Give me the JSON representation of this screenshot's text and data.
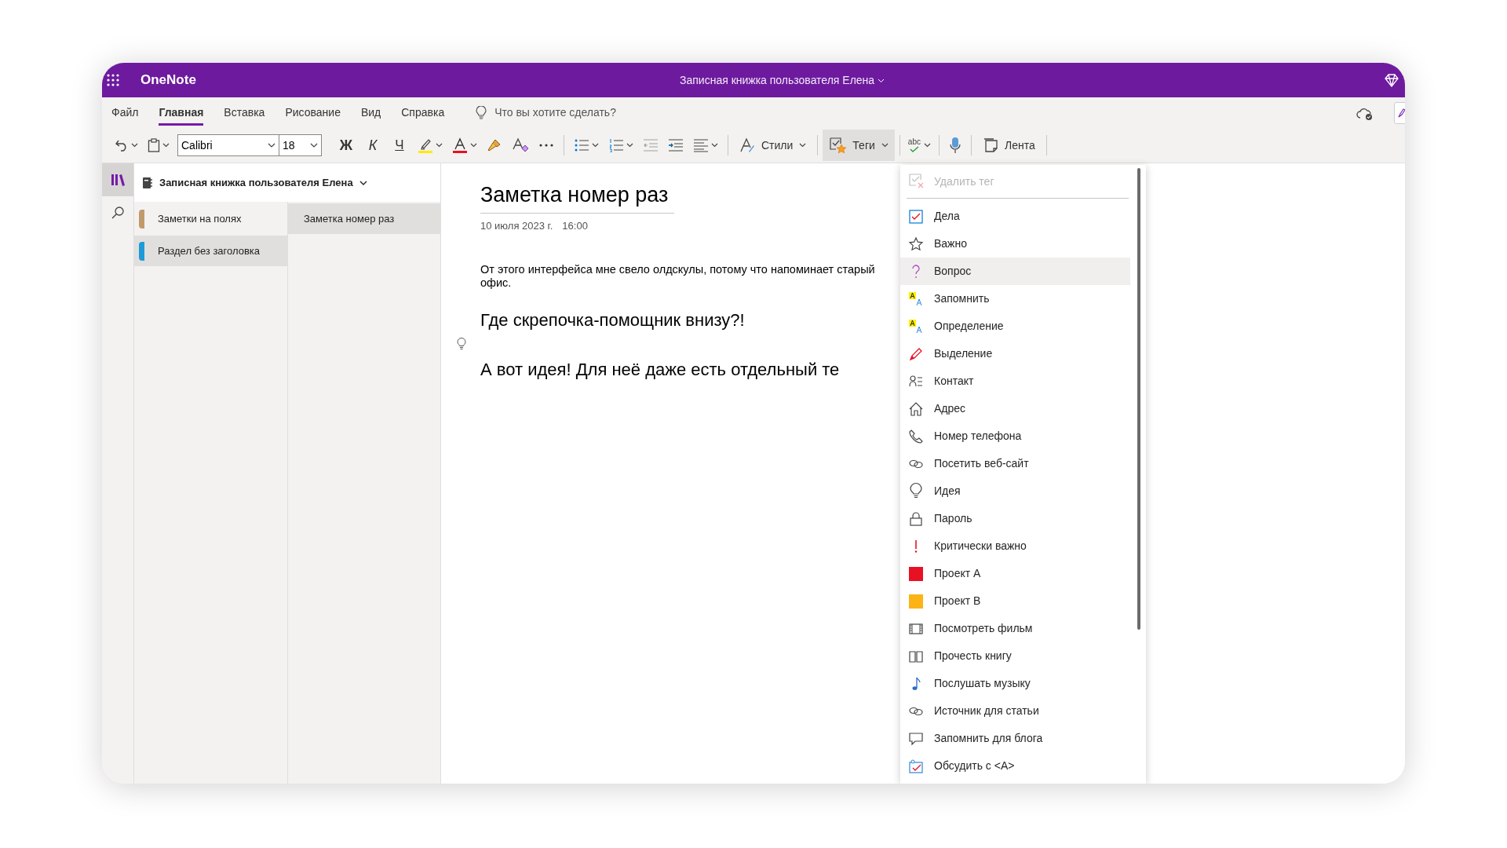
{
  "app": {
    "name": "OneNote",
    "title": "Записная книжка пользователя Елена"
  },
  "ribbon_tabs": [
    {
      "label": "Файл",
      "selected": false
    },
    {
      "label": "Главная",
      "selected": true
    },
    {
      "label": "Вставка",
      "selected": false
    },
    {
      "label": "Рисование",
      "selected": false
    },
    {
      "label": "Вид",
      "selected": false
    },
    {
      "label": "Справка",
      "selected": false
    }
  ],
  "tell_me": {
    "placeholder": "Что вы хотите сделать?"
  },
  "toolbar": {
    "font": "Calibri",
    "size": "18",
    "bold": "Ж",
    "italic": "К",
    "underline": "Ч",
    "spelling": "abc",
    "buttons": [
      {
        "kind": "styles",
        "label": "Стили",
        "selected": false
      },
      {
        "kind": "tags",
        "label": "Теги",
        "selected": true
      },
      {
        "kind": "feed",
        "label": "Лента",
        "selected": false
      }
    ]
  },
  "nav_rail": [
    {
      "kind": "notebooks",
      "selected": true
    },
    {
      "kind": "search",
      "selected": false
    }
  ],
  "notebook": {
    "title": "Записная книжка пользователя Елена"
  },
  "sections": [
    {
      "label": "Заметки на полях",
      "color": "#c19a6b",
      "selected": false
    },
    {
      "label": "Раздел без заголовка",
      "color": "#1e9bd7",
      "selected": true
    }
  ],
  "pages": [
    {
      "label": "Заметка номер раз",
      "selected": true
    }
  ],
  "note": {
    "title": "Заметка номер раз",
    "date": "10 июля 2023 г.",
    "time": "16:00",
    "blocks": [
      {
        "kind": "paragraph",
        "text": "От этого интерфейса мне свело олдскулы, потому что напоминает старый офис."
      },
      {
        "kind": "heading",
        "text": "Где скрепочка-помощник внизу?!"
      },
      {
        "kind": "heading",
        "text": "А вот идея! Для неё даже есть отдельный те"
      }
    ]
  },
  "tags_menu": {
    "remove": {
      "label": "Удалить тег",
      "disabled": true
    },
    "items": [
      {
        "kind": "todo",
        "label": "Дела",
        "selected": false
      },
      {
        "kind": "star",
        "label": "Важно",
        "selected": false
      },
      {
        "kind": "question",
        "label": "Вопрос",
        "selected": true
      },
      {
        "kind": "letters",
        "label": "Запомнить",
        "selected": false
      },
      {
        "kind": "letters",
        "label": "Определение",
        "selected": false
      },
      {
        "kind": "pen",
        "label": "Выделение",
        "selected": false
      },
      {
        "kind": "contact",
        "label": "Контакт",
        "selected": false
      },
      {
        "kind": "home",
        "label": "Адрес",
        "selected": false
      },
      {
        "kind": "phone",
        "label": "Номер телефона",
        "selected": false
      },
      {
        "kind": "link",
        "label": "Посетить веб-сайт",
        "selected": false
      },
      {
        "kind": "bulb",
        "label": "Идея",
        "selected": false
      },
      {
        "kind": "lock",
        "label": "Пароль",
        "selected": false
      },
      {
        "kind": "critical",
        "label": "Критически важно",
        "selected": false
      },
      {
        "kind": "project",
        "label": "Проект A",
        "color": "#e81123",
        "selected": false
      },
      {
        "kind": "project",
        "label": "Проект B",
        "color": "#fcb315",
        "selected": false
      },
      {
        "kind": "film",
        "label": "Посмотреть фильм",
        "selected": false
      },
      {
        "kind": "book",
        "label": "Прочесть книгу",
        "selected": false
      },
      {
        "kind": "music",
        "label": "Послушать музыку",
        "selected": false
      },
      {
        "kind": "link",
        "label": "Источник для статьи",
        "selected": false
      },
      {
        "kind": "comment",
        "label": "Запомнить для блога",
        "selected": false
      },
      {
        "kind": "discuss",
        "label": "Обсудить с <A>",
        "selected": false
      }
    ]
  }
}
